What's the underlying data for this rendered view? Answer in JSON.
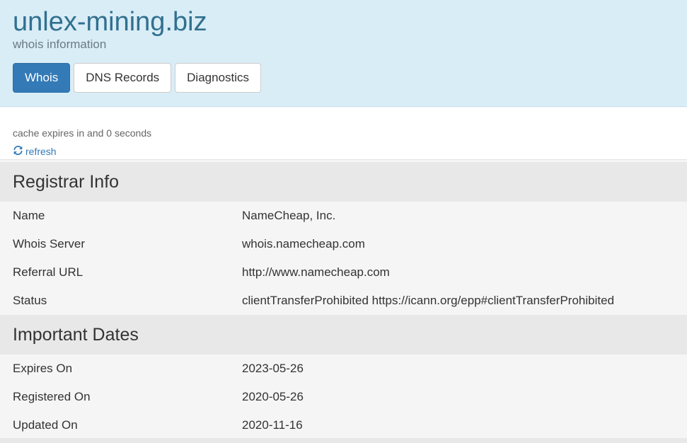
{
  "header": {
    "domain": "unlex-mining.biz",
    "subtitle": "whois information",
    "tabs": [
      {
        "label": "Whois",
        "active": true
      },
      {
        "label": "DNS Records",
        "active": false
      },
      {
        "label": "Diagnostics",
        "active": false
      }
    ]
  },
  "cache": {
    "text": "cache expires in and 0 seconds",
    "refresh_label": "refresh",
    "refresh_icon": "refresh-icon"
  },
  "registrar": {
    "title": "Registrar Info",
    "rows": [
      {
        "label": "Name",
        "value": "NameCheap, Inc."
      },
      {
        "label": "Whois Server",
        "value": "whois.namecheap.com"
      },
      {
        "label": "Referral URL",
        "value": "http://www.namecheap.com"
      },
      {
        "label": "Status",
        "value": "clientTransferProhibited https://icann.org/epp#clientTransferProhibited"
      }
    ]
  },
  "dates": {
    "title": "Important Dates",
    "rows": [
      {
        "label": "Expires On",
        "value": "2023-05-26"
      },
      {
        "label": "Registered On",
        "value": "2020-05-26"
      },
      {
        "label": "Updated On",
        "value": "2020-11-16"
      }
    ]
  },
  "colors": {
    "header_bg": "#d9edf7",
    "title": "#31708f",
    "primary": "#337ab7",
    "section_bg": "#e8e8e8"
  }
}
